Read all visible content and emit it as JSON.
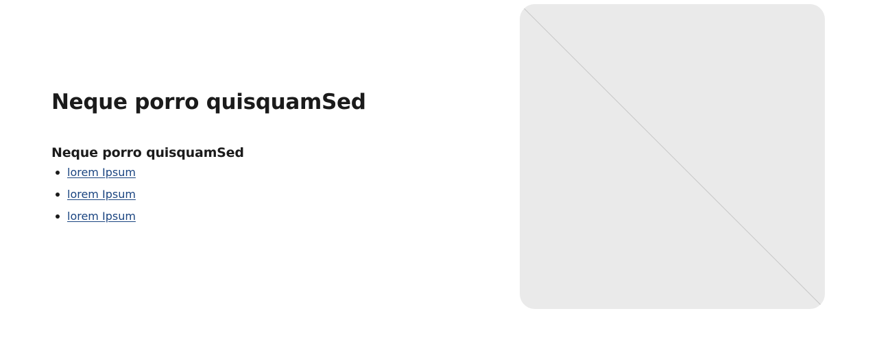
{
  "section": {
    "title": "Neque porro quisquamSed",
    "subtitle": "Neque porro quisquamSed",
    "links": [
      {
        "label": "lorem Ipsum"
      },
      {
        "label": "lorem Ipsum"
      },
      {
        "label": "lorem Ipsum"
      }
    ]
  },
  "media": {
    "icon": "image-placeholder-icon",
    "background_color": "#eaeaea",
    "line_color": "#c8c8c8"
  },
  "colors": {
    "text": "#1b1b1b",
    "link": "#1a4480",
    "page_background": "#ffffff"
  }
}
